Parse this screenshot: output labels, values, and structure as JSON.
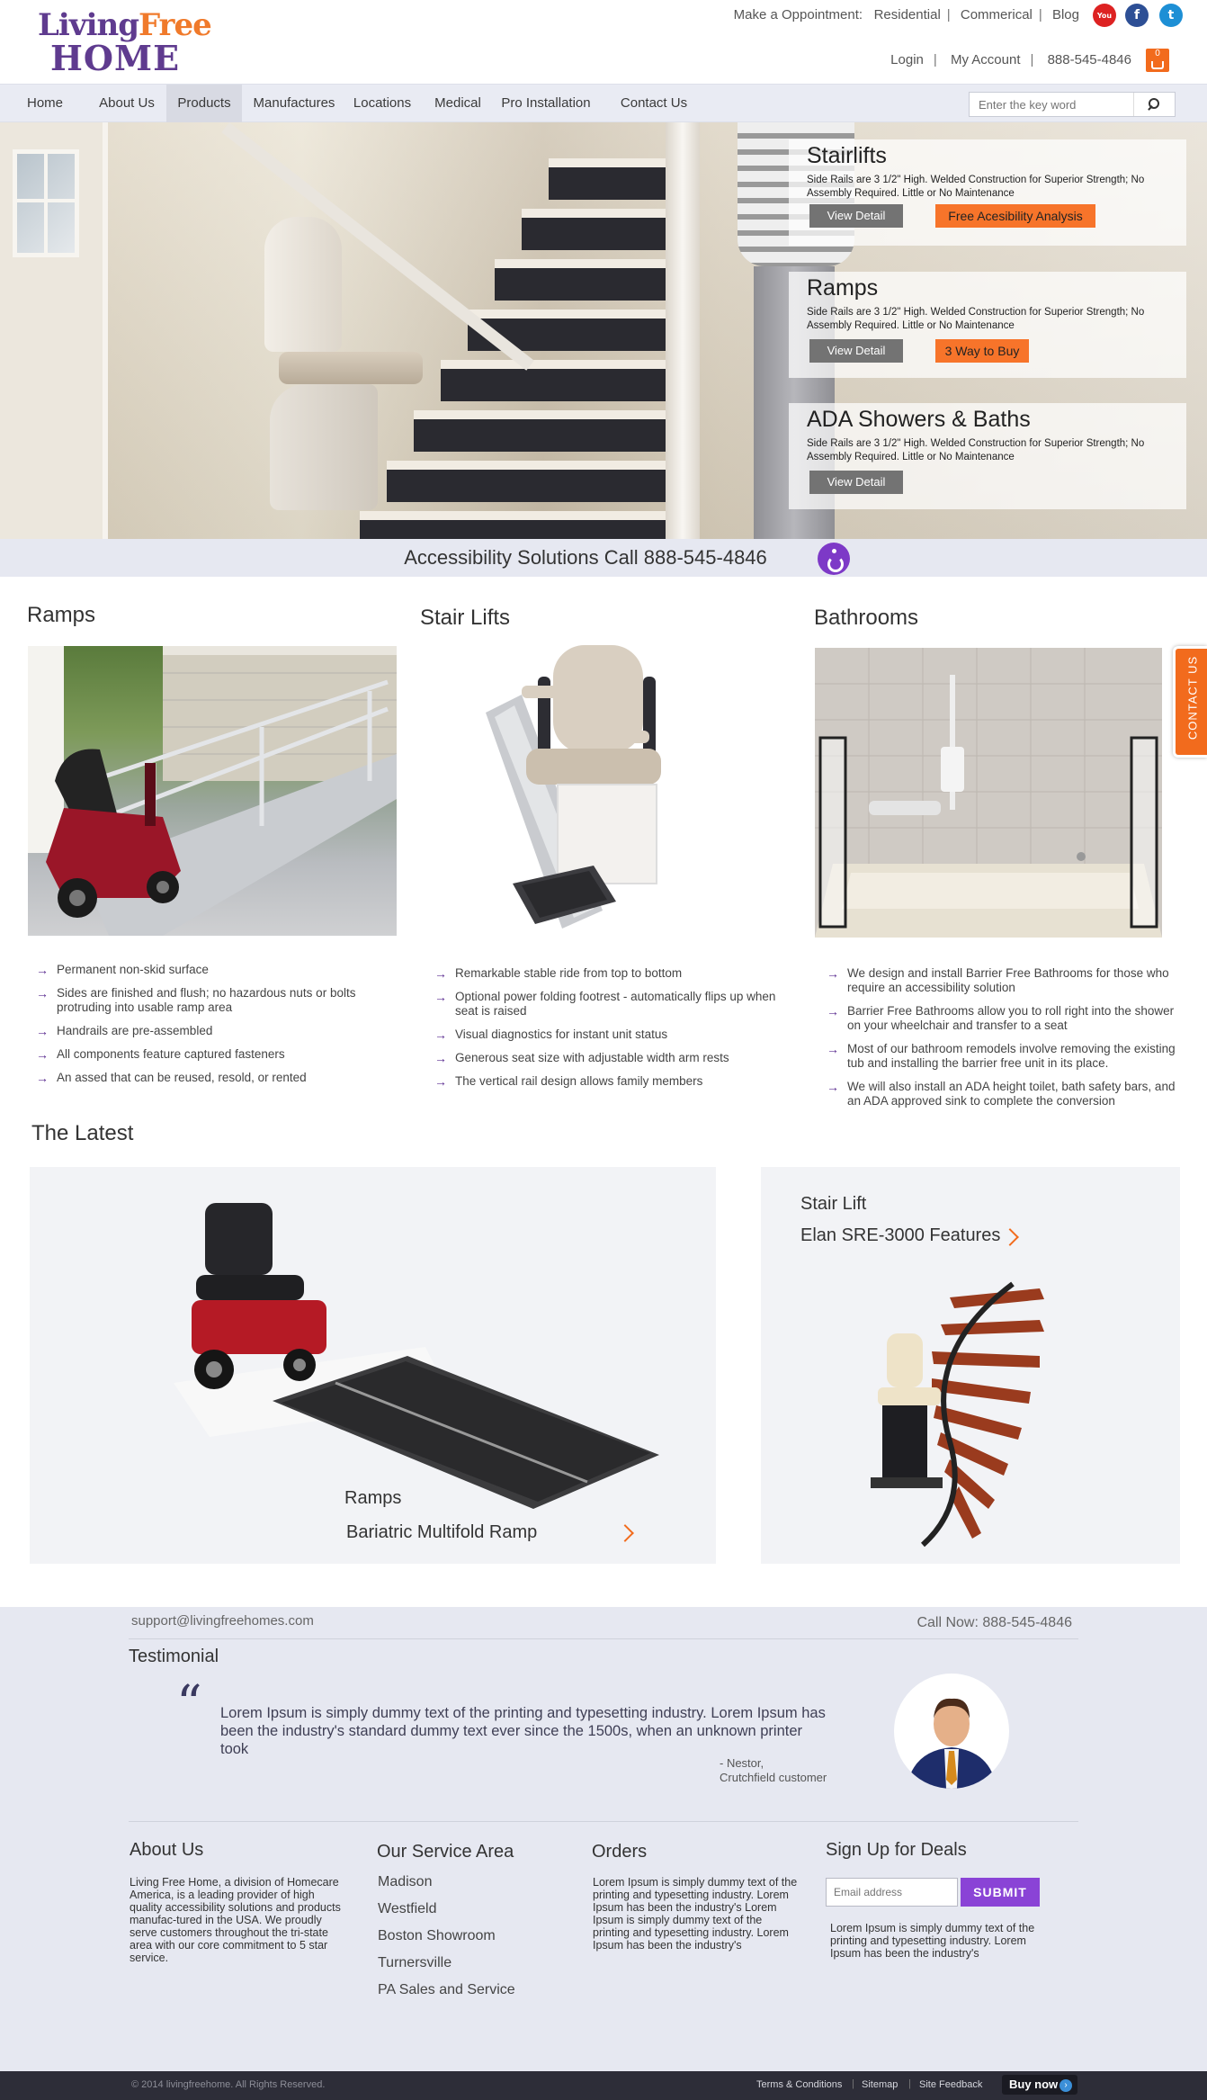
{
  "header": {
    "logo": {
      "living": "Living",
      "free": "Free",
      "home": "HOME"
    },
    "top_links": {
      "appointment_label": "Make a Oppointment:",
      "residential": "Residential",
      "commercial": "Commerical",
      "blog": "Blog",
      "sep": "|"
    },
    "social_icons": [
      "youtube-icon",
      "facebook-icon",
      "twitter-icon"
    ],
    "account_links": {
      "login": "Login",
      "my_account": "My Account",
      "phone": "888-545-4846",
      "sep": "|"
    },
    "cart": {
      "count": "0",
      "icon": "cart-icon"
    }
  },
  "nav": {
    "items": [
      {
        "label": "Home"
      },
      {
        "label": "About Us"
      },
      {
        "label": "Products"
      },
      {
        "label": "Manufactures"
      },
      {
        "label": "Locations"
      },
      {
        "label": "Medical"
      },
      {
        "label": "Pro Installation"
      },
      {
        "label": "Contact Us"
      }
    ],
    "active_item": "Products",
    "search": {
      "placeholder": "Enter the key word",
      "icon": "search-icon"
    }
  },
  "hero": {
    "promos": [
      {
        "title": "Stairlifts",
        "text": "Side Rails are 3 1/2\" High. Welded Construction for Superior Strength; No Assembly Required. Little or No Maintenance",
        "detail_button": "View Detail",
        "action_button": "Free Acesibility Analysis"
      },
      {
        "title": "Ramps",
        "text": "Side Rails are 3 1/2\" High. Welded Construction for Superior Strength; No Assembly Required. Little or No Maintenance",
        "detail_button": "View Detail",
        "action_button": "3 Way to Buy"
      },
      {
        "title": "ADA Showers & Baths",
        "text": "Side Rails are 3 1/2\" High. Welded Construction for Superior Strength; No Assembly Required. Little or No Maintenance",
        "detail_button": "View Detail"
      }
    ]
  },
  "call_strip": {
    "text": "Accessibility Solutions Call 888-545-4846",
    "icon": "wheelchair-icon"
  },
  "categories": [
    {
      "title": "Ramps",
      "bullets": [
        "Permanent non-skid surface",
        "Sides are finished and flush; no hazardous nuts or bolts protruding into usable ramp area",
        "Handrails are pre-assembled",
        "All components feature captured fasteners",
        "An assed that can be reused, resold, or rented"
      ]
    },
    {
      "title": "Stair Lifts",
      "bullets": [
        "Remarkable stable ride from top to bottom",
        "Optional power folding footrest - automatically flips up when seat is raised",
        "Visual diagnostics for instant unit status",
        "Generous seat size with adjustable width arm rests",
        "The vertical rail design allows family members"
      ]
    },
    {
      "title": "Bathrooms",
      "bullets": [
        "We design and install Barrier Free Bathrooms for those who require an accessibility solution",
        "Barrier Free Bathrooms allow you to roll right into the shower on your wheelchair and transfer to a seat",
        "Most of our bathroom remodels involve removing the existing tub and installing the barrier free unit in its place.",
        "We will also install an ADA height toilet, bath safety bars, and an ADA approved sink to complete the conversion"
      ]
    }
  ],
  "contact_tab": "CONTACT US",
  "latest": {
    "title": "The Latest",
    "items": [
      {
        "category": "Ramps",
        "name": "Bariatric Multifold Ramp"
      },
      {
        "category": "Stair Lift",
        "name": "Elan SRE-3000 Features"
      }
    ]
  },
  "footer": {
    "support_email": "support@livingfreehomes.com",
    "call_now": "Call Now: 888-545-4846",
    "testimonial": {
      "title": "Testimonial",
      "quote_mark": "“",
      "text": "Lorem Ipsum is simply dummy text of the printing and typesetting industry. Lorem Ipsum has been the industry's standard dummy text ever since the 1500s, when an unknown printer took",
      "author": "- Nestor,",
      "author_role": "Crutchfield customer"
    },
    "about": {
      "title": "About Us",
      "text": "Living Free Home, a division of Homecare America, is a leading provider of high quality accessibility solutions and products manufac-tured in the USA. We proudly serve customers throughout the tri-state area with our core commitment to 5 star service."
    },
    "service_area": {
      "title": "Our Service Area",
      "links": [
        "Madison",
        "Westfield",
        "Boston Showroom",
        "Turnersville",
        "PA Sales and Service"
      ]
    },
    "orders": {
      "title": "Orders",
      "text": "Lorem Ipsum is simply dummy text of the printing and typesetting industry. Lorem Ipsum has been the industry's Lorem Ipsum is simply dummy text of the printing and typesetting industry. Lorem Ipsum has been the industry's"
    },
    "signup": {
      "title": "Sign Up for Deals",
      "placeholder": "Email address",
      "button": "SUBMIT",
      "text": "Lorem Ipsum is simply dummy text of the printing and typesetting industry. Lorem Ipsum has been the industry's"
    }
  },
  "bottom_bar": {
    "copyright": "© 2014 livingfreehome. All Rights Reserved.",
    "links": [
      "Terms & Conditions",
      "Sitemap",
      "Site Feedback"
    ],
    "sep": "|",
    "buy_now": "Buy now",
    "buy_now_icon": "arrow-right-icon"
  },
  "colors": {
    "brand_purple": "#5f3b8f",
    "accent_orange": "#f26b1d",
    "submit_purple": "#8a43d6",
    "footer_bg": "#e6e8f1",
    "bottom_bar": "#2d2d38"
  }
}
